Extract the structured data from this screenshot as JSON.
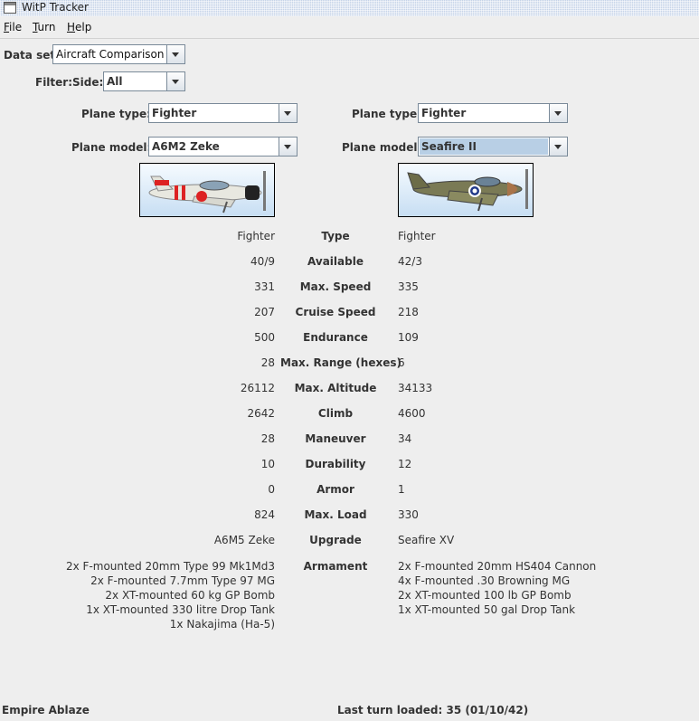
{
  "window": {
    "title": "WitP Tracker"
  },
  "menu": [
    "File",
    "Turn",
    "Help"
  ],
  "dataset": {
    "label": "Data set:",
    "value": "Aircraft Comparison"
  },
  "filter": {
    "label": "Filter:",
    "side_label": "Side:",
    "side_value": "All"
  },
  "left": {
    "plane_type_label": "Plane type:",
    "plane_type": "Fighter",
    "plane_model_label": "Plane model:",
    "plane_model": "A6M2 Zeke"
  },
  "right": {
    "plane_type_label": "Plane type:",
    "plane_type": "Fighter",
    "plane_model_label": "Plane model:",
    "plane_model": "Seafire II"
  },
  "stats": [
    {
      "label": "Type",
      "left": "Fighter",
      "right": "Fighter"
    },
    {
      "label": "Available",
      "left": "40/9",
      "right": "42/3"
    },
    {
      "label": "Max. Speed",
      "left": "331",
      "right": "335"
    },
    {
      "label": "Cruise Speed",
      "left": "207",
      "right": "218"
    },
    {
      "label": "Endurance",
      "left": "500",
      "right": "109"
    },
    {
      "label": "Max. Range (hexes)",
      "left": "28",
      "right": "6"
    },
    {
      "label": "Max. Altitude",
      "left": "26112",
      "right": "34133"
    },
    {
      "label": "Climb",
      "left": "2642",
      "right": "4600"
    },
    {
      "label": "Maneuver",
      "left": "28",
      "right": "34"
    },
    {
      "label": "Durability",
      "left": "10",
      "right": "12"
    },
    {
      "label": "Armor",
      "left": "0",
      "right": "1"
    },
    {
      "label": "Max. Load",
      "left": "824",
      "right": "330"
    },
    {
      "label": "Upgrade",
      "left": "A6M5 Zeke",
      "right": "Seafire XV"
    }
  ],
  "armament": {
    "label": "Armament",
    "left": [
      "2x F-mounted 20mm Type 99 Mk1Md3",
      "2x F-mounted 7.7mm Type 97 MG",
      "2x XT-mounted 60 kg GP Bomb",
      "1x XT-mounted 330 litre Drop Tank",
      "1x Nakajima (Ha-5)"
    ],
    "right": [
      "2x F-mounted 20mm HS404 Cannon",
      "4x F-mounted .30 Browning MG",
      "2x XT-mounted 100 lb GP Bomb",
      "1x XT-mounted 50 gal Drop Tank"
    ]
  },
  "status": {
    "scenario": "Empire Ablaze",
    "last_turn": "Last turn loaded: 35 (01/10/42)"
  }
}
